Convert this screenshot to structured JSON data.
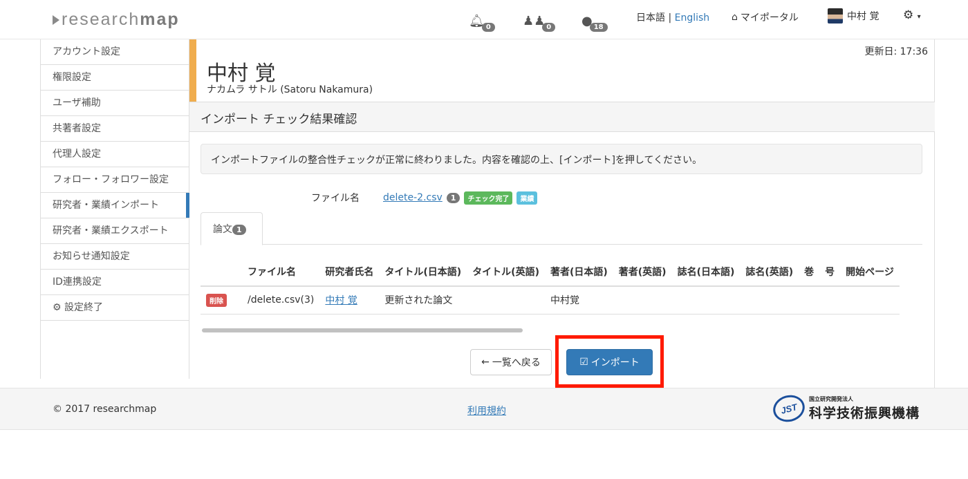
{
  "header": {
    "logo_prefix": "research",
    "logo_suffix": "map",
    "notifications_count": "0",
    "followers_count": "0",
    "global_count": "18",
    "lang_ja": "日本語",
    "lang_sep": " | ",
    "lang_en": "English",
    "portal_label": "マイポータル",
    "user_name": "中村 覚"
  },
  "sidebar": {
    "items": [
      {
        "label": "アカウント設定"
      },
      {
        "label": "権限設定"
      },
      {
        "label": "ユーザ補助"
      },
      {
        "label": "共著者設定"
      },
      {
        "label": "代理人設定"
      },
      {
        "label": "フォロー・フォロワー設定"
      },
      {
        "label": "研究者・業績インポート"
      },
      {
        "label": "研究者・業績エクスポート"
      },
      {
        "label": "お知らせ通知設定"
      },
      {
        "label": "ID連携設定"
      },
      {
        "label": "設定終了"
      }
    ]
  },
  "profile": {
    "updated": "更新日: 17:36",
    "name": "中村 覚",
    "kana": "ナカムラ サトル  (Satoru Nakamura)"
  },
  "page": {
    "section_title": "インポート チェック結果確認",
    "alert": "インポートファイルの整合性チェックが正常に終わりました。内容を確認の上、[インポート]を押してください。",
    "file_label": "ファイル名",
    "file_name": "delete-2.csv",
    "file_count": "1",
    "check_badge": "チェック完了",
    "type_badge": "業績",
    "tab_label": "論文",
    "tab_count": "1"
  },
  "table": {
    "headers": [
      "ファイル名",
      "研究者氏名",
      "タイトル(日本語)",
      "タイトル(英語)",
      "著者(日本語)",
      "著者(英語)",
      "誌名(日本語)",
      "誌名(英語)",
      "巻",
      "号",
      "開始ページ"
    ],
    "rows": [
      {
        "action": "削除",
        "file": "/delete.csv(3)",
        "researcher": "中村 覚",
        "title_ja": "更新された論文",
        "title_en": "",
        "author_ja": "中村覚",
        "author_en": "",
        "journal_ja": "",
        "journal_en": "",
        "vol": "",
        "no": "",
        "start_page": ""
      }
    ]
  },
  "buttons": {
    "back": "一覧へ戻る",
    "import": "インポート"
  },
  "footer": {
    "copyright": "2017 researchmap",
    "terms": "利用規約",
    "org_small": "国立研究開発法人",
    "org_big": "科学技術振興機構"
  },
  "colors": {
    "accent_orange": "#f0ad4e",
    "primary_blue": "#337ab7",
    "highlight_red": "#ff1a00"
  }
}
